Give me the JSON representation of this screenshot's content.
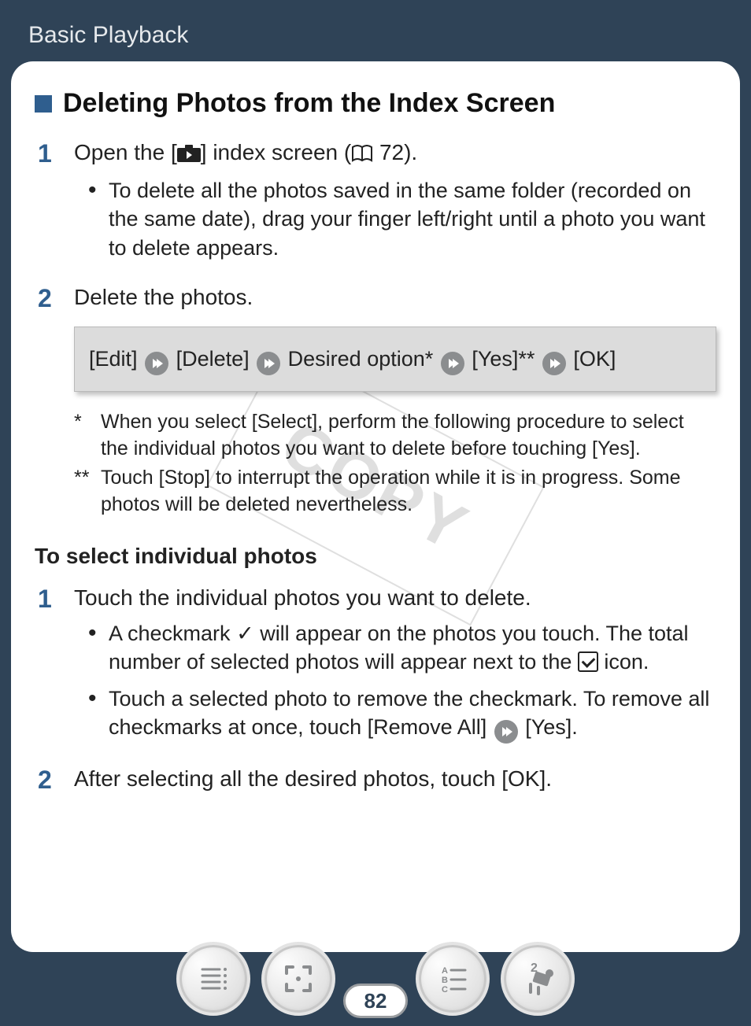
{
  "header": {
    "title": "Basic Playback"
  },
  "section_title": "Deleting Photos from the Index Screen",
  "steps_a": [
    {
      "num": "1",
      "line_a": "Open the [",
      "line_b": "] index screen (",
      "line_c": " 72).",
      "bullets": [
        "To delete all the photos saved in the same folder (recorded on the same date), drag your finger left/right until a photo you want to delete appears."
      ]
    },
    {
      "num": "2",
      "line": "Delete the photos."
    }
  ],
  "path": {
    "seg1": "[Edit]",
    "seg2": "[Delete]",
    "seg3": "Desired option*",
    "seg4": "[Yes]**",
    "seg5": "[OK]"
  },
  "footnotes": [
    {
      "mark": "*",
      "text": "When you select [Select], perform the following procedure to select the individual photos you want to delete before touching [Yes]."
    },
    {
      "mark": "**",
      "text": "Touch [Stop] to interrupt the operation while it is in progress. Some photos will be deleted nevertheless."
    }
  ],
  "subheading": "To select individual photos",
  "steps_b": [
    {
      "num": "1",
      "line": "Touch the individual photos you want to delete.",
      "bullets": [
        {
          "a": "A checkmark ",
          "check": "✓",
          "b": " will appear on the photos you touch. The total number of selected photos will appear next to the ",
          "c": " icon."
        },
        {
          "a": "Touch a selected photo to remove the checkmark. To remove all checkmarks at once, touch [Remove All] ",
          "b": " [Yes]."
        }
      ]
    },
    {
      "num": "2",
      "line": "After selecting all the desired photos, touch [OK]."
    }
  ],
  "watermark": "COPY",
  "page_number": "82"
}
